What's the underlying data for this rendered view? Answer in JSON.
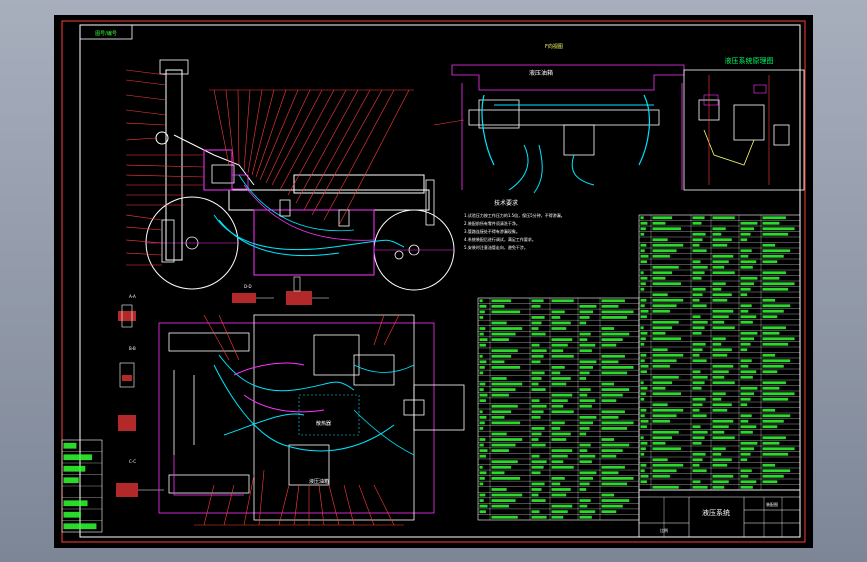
{
  "drawing": {
    "corner_stamp": "图号/编号",
    "top_view_label": "F向视图",
    "tank_label": "液压油箱",
    "schematic_title": "液压系统原理图",
    "tech_req_title": "技术要求",
    "tech_req_lines": [
      "1.试验压力按工作压力的1.5倍，保压5分钟，不得渗漏。",
      "2.装配前所有零件须清洗干净。",
      "3.管路连接处不得有渗漏现象。",
      "4.系统装配后进行调试，满足工作要求。",
      "5.安装时注意油管走向，避免干涉。"
    ],
    "section_labels": [
      "A-A",
      "B-B",
      "C-C",
      "D-D"
    ],
    "plan_labels": [
      "散热器",
      "液压油箱"
    ],
    "title_block_name": "液压系统",
    "title_block_sub": "装配图",
    "title_block_small": "比例"
  },
  "colors": {
    "background": "#000000",
    "frame": "#ffffff",
    "leader": "#ff3b3b",
    "hose": "#00e5ff",
    "component": "#ff33ff",
    "table_text": "#33ff33",
    "table_line": "#ffffff",
    "title_text": "#00ff66"
  }
}
